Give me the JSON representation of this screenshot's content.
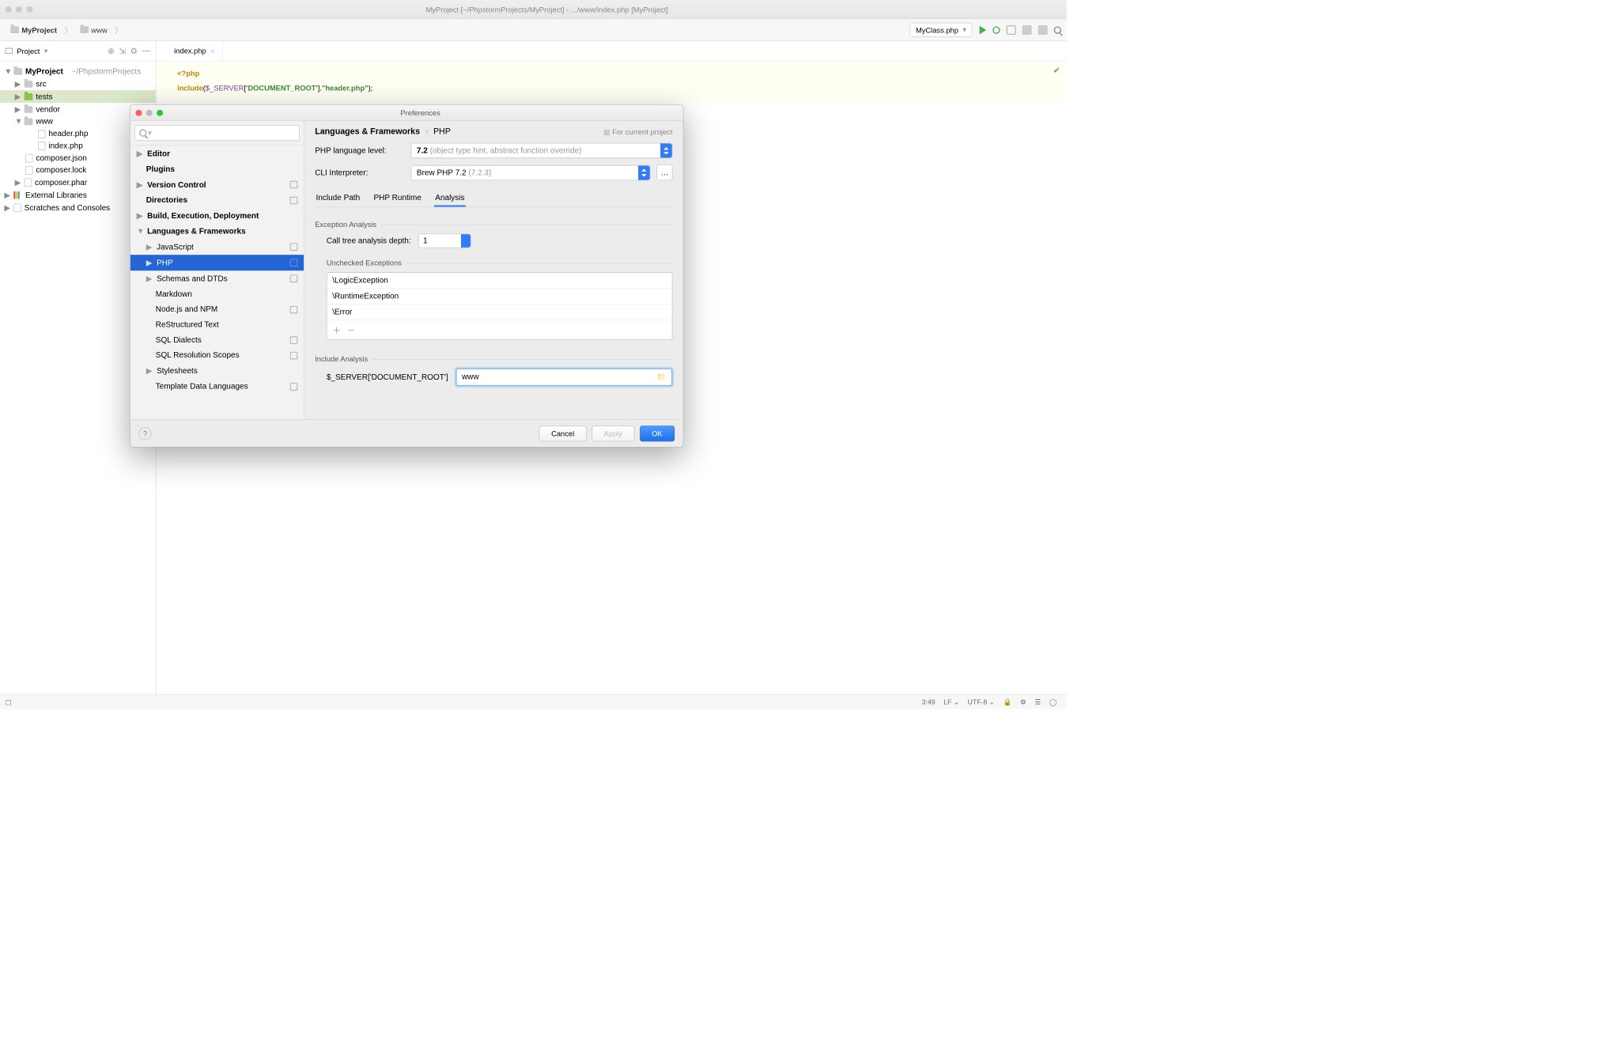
{
  "window": {
    "title": "MyProject [~/PhpstormProjects/MyProject] - .../www/index.php [MyProject]"
  },
  "breadcrumb": {
    "seg1": "MyProject",
    "seg2": "www"
  },
  "file_combo": "MyClass.php",
  "sidebar_header": "Project",
  "project_tree": {
    "root": "MyProject",
    "root_path": "~/PhpstormProjects",
    "src": "src",
    "tests": "tests",
    "vendor": "vendor",
    "www": "www",
    "header_php": "header.php",
    "index_php": "index.php",
    "composer_json": "composer.json",
    "composer_lock": "composer.lock",
    "composer_phar": "composer.phar",
    "ext_lib": "External Libraries",
    "scratches": "Scratches and Consoles"
  },
  "tab": {
    "name": "index.php"
  },
  "code": {
    "open": "<?php",
    "include": "include",
    "server": "$_SERVER",
    "key": "'DOCUMENT_ROOT'",
    "cat": ".",
    "file": "\"header.php\"",
    "close": ");"
  },
  "dialog": {
    "title": "Preferences",
    "search_placeholder": "",
    "tree": {
      "editor": "Editor",
      "plugins": "Plugins",
      "vcs": "Version Control",
      "dirs": "Directories",
      "build": "Build, Execution, Deployment",
      "lang": "Languages & Frameworks",
      "js": "JavaScript",
      "php": "PHP",
      "schemas": "Schemas and DTDs",
      "markdown": "Markdown",
      "node": "Node.js and NPM",
      "rst": "ReStructured Text",
      "sql": "SQL Dialects",
      "sqlres": "SQL Resolution Scopes",
      "style": "Stylesheets",
      "tmpl": "Template Data Languages"
    },
    "crumb": {
      "a": "Languages & Frameworks",
      "b": "PHP",
      "hint": "For current project"
    },
    "lang_level": {
      "label": "PHP language level:",
      "value": "7.2",
      "hint": "(object type hint, abstract function override)"
    },
    "cli": {
      "label": "CLI Interpreter:",
      "value": "Brew PHP 7.2",
      "hint": "(7.2.3)"
    },
    "tabs": {
      "include": "Include Path",
      "runtime": "PHP Runtime",
      "analysis": "Analysis"
    },
    "exception": {
      "title": "Exception Analysis",
      "depth_label": "Call tree analysis depth:",
      "depth_value": "1",
      "unchecked_title": "Unchecked Exceptions",
      "items": [
        "\\LogicException",
        "\\RuntimeException",
        "\\Error"
      ]
    },
    "include": {
      "title": "Include Analysis",
      "label": "$_SERVER['DOCUMENT_ROOT']",
      "value": "www"
    },
    "buttons": {
      "cancel": "Cancel",
      "apply": "Apply",
      "ok": "OK"
    }
  },
  "status": {
    "pos": "3:49",
    "le": "LF",
    "enc": "UTF-8"
  }
}
